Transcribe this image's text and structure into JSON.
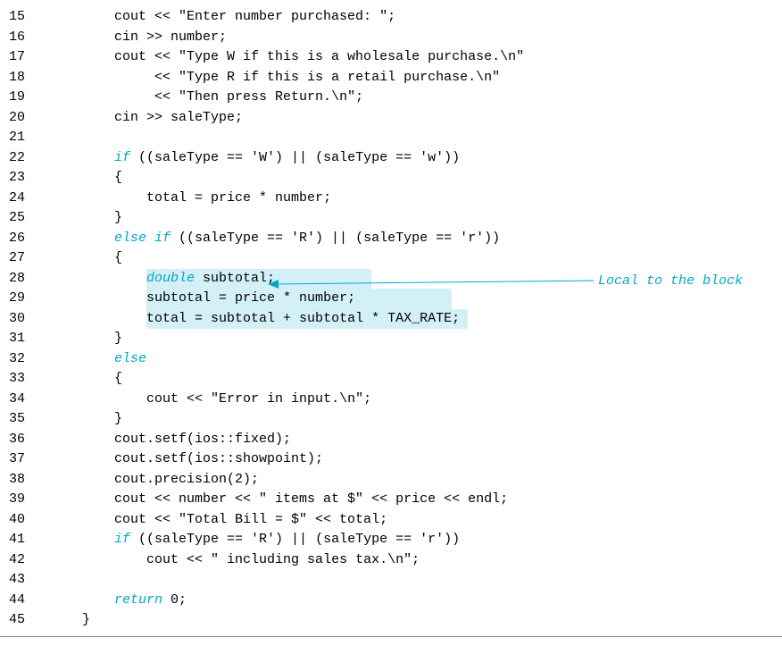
{
  "lines": {
    "n15": "15",
    "c15": "cout << \"Enter number purchased: \";",
    "n16": "16",
    "c16": "cin >> number;",
    "n17": "17",
    "c17": "cout << \"Type W if this is a wholesale purchase.\\n\"",
    "n18": "18",
    "c18": "<< \"Type R if this is a retail purchase.\\n\"",
    "n19": "19",
    "c19": "<< \"Then press Return.\\n\";",
    "n20": "20",
    "c20": "cin >> saleType;",
    "n21": "21",
    "c21": "",
    "n22": "22",
    "c22a": "if",
    "c22b": " ((saleType == 'W') || (saleType == 'w'))",
    "n23": "23",
    "c23": "{",
    "n24": "24",
    "c24": "total = price * number;",
    "n25": "25",
    "c25": "}",
    "n26": "26",
    "c26a": "else if",
    "c26b": " ((saleType == 'R') || (saleType == 'r'))",
    "n27": "27",
    "c27": "{",
    "n28": "28",
    "c28a": "double",
    "c28b": " subtotal;",
    "n29": "29",
    "c29": "subtotal = price * number;",
    "n30": "30",
    "c30": "total = subtotal + subtotal * TAX_RATE;",
    "n31": "31",
    "c31": "}",
    "n32": "32",
    "c32": "else",
    "n33": "33",
    "c33": "{",
    "n34": "34",
    "c34": "cout << \"Error in input.\\n\";",
    "n35": "35",
    "c35": "}",
    "n36": "36",
    "c36": "cout.setf(ios::fixed);",
    "n37": "37",
    "c37": "cout.setf(ios::showpoint);",
    "n38": "38",
    "c38": "cout.precision(2);",
    "n39": "39",
    "c39": "cout << number << \" items at $\" << price << endl;",
    "n40": "40",
    "c40": "cout << \"Total Bill = $\" << total;",
    "n41": "41",
    "c41a": "if",
    "c41b": " ((saleType == 'R') || (saleType == 'r'))",
    "n42": "42",
    "c42": "cout << \" including sales tax.\\n\";",
    "n43": "43",
    "c43": "",
    "n44": "44",
    "c44a": "return",
    "c44b": " 0;",
    "n45": "45",
    "c45": "}"
  },
  "annotation": {
    "text": "Local to the block"
  },
  "indent": {
    "lvl0": "    ",
    "lvl1": "        ",
    "lvl2": "            ",
    "lvl3": "             "
  },
  "colors": {
    "keyword": "#00a8c8",
    "highlight": "#d4f0f7"
  }
}
